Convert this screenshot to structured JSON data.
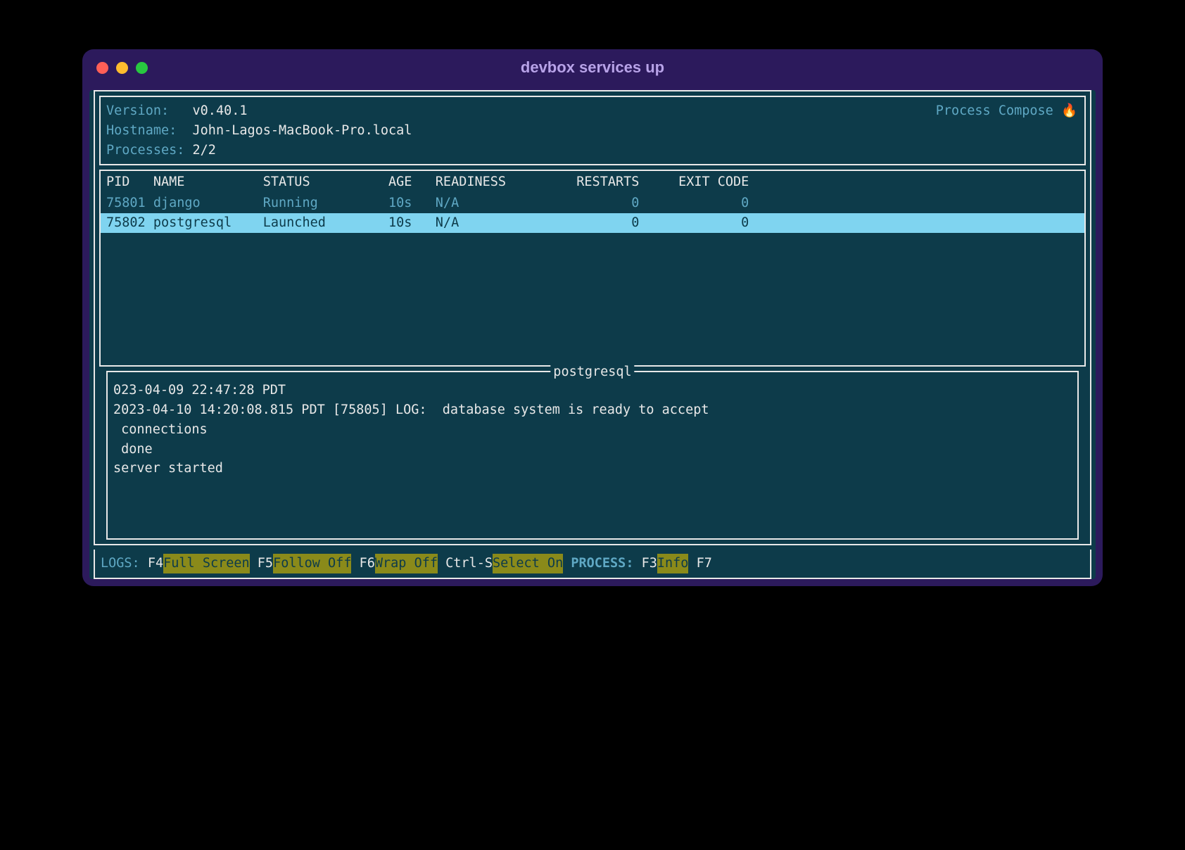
{
  "window": {
    "title": "devbox services up"
  },
  "header": {
    "version_label": "Version:  ",
    "version_value": "v0.40.1",
    "hostname_label": "Hostname: ",
    "hostname_value": "John-Lagos-MacBook-Pro.local",
    "processes_label": "Processes:",
    "processes_value": "2/2",
    "app_name": "Process Compose ",
    "fire_icon": "🔥"
  },
  "table": {
    "headers": {
      "pid": "PID",
      "name": "NAME",
      "status": "STATUS",
      "age": "AGE",
      "readiness": "READINESS",
      "restarts": "RESTARTS",
      "exit_code": "EXIT CODE"
    },
    "rows": [
      {
        "pid": "75801",
        "name": "django",
        "status": "Running",
        "age": "10s",
        "readiness": "N/A",
        "restarts": "0",
        "exit_code": "0",
        "selected": false
      },
      {
        "pid": "75802",
        "name": "postgresql",
        "status": "Launched",
        "age": "10s",
        "readiness": "N/A",
        "restarts": "0",
        "exit_code": "0",
        "selected": true
      }
    ]
  },
  "logs": {
    "title": "postgresql",
    "lines": [
      "023-04-09 22:47:28 PDT",
      "2023-04-10 14:20:08.815 PDT [75805] LOG:  database system is ready to accept",
      " connections",
      " done",
      "server started"
    ]
  },
  "footer": {
    "logs_label": "LOGS:",
    "f4_key": "F4",
    "f4_action": "Full Screen",
    "f5_key": "F5",
    "f5_action": "Follow Off",
    "f6_key": "F6",
    "f6_action": "Wrap Off",
    "ctrls_key": "Ctrl-S",
    "ctrls_action": "Select On",
    "process_label": "PROCESS:",
    "f3_key": "F3",
    "f3_action": "Info",
    "f7_key": "F7"
  }
}
